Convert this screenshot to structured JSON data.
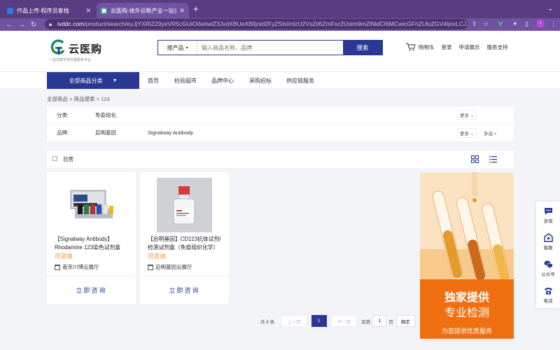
{
  "browser": {
    "tabs": [
      {
        "title": "作品上传-程序员客栈"
      },
      {
        "title": "云医购-体外诊断产业一站式服务"
      }
    ],
    "url_domain": "ivddc.com",
    "url_path": "/product/search/eyJjYXRlZ29yeVR5cGUiOiIwIiwiZ3JvdXBUeXBlIjoid2FyZSIsImlzU2VsZiI6ZmFsc2UsIm9mZlNldCI6MCwicGFnZUluZGV4IjoxLCJ...",
    "avatar_letter": "i"
  },
  "header": {
    "logo_name": "云医购",
    "logo_tagline": "一站式数字供应链服务平台",
    "search_scope": "搜产品",
    "search_placeholder": "输入商品名称、品牌",
    "search_button": "搜索",
    "links": [
      "购物车",
      "登录",
      "申请展示",
      "服务支持"
    ]
  },
  "nav": {
    "all_categories": "全部商品分类",
    "items": [
      "首页",
      "检验超市",
      "品牌中心",
      "采购招标",
      "供应链服务"
    ]
  },
  "breadcrumb": "全部商品 > 商品搜索 > 123",
  "filters": {
    "category_label": "分类:",
    "category_value": "免疫组化",
    "brand_label": "品牌:",
    "brands": [
      "启明基因",
      "Signalway Antibody"
    ],
    "more": "更多",
    "multi": "多选"
  },
  "toolbar": {
    "self_label": "自营"
  },
  "products": [
    {
      "title": "【Signalway Antibody】Rhodamine 123染色试剂盒",
      "price": "可咨询",
      "shop": "南京川博云展厅",
      "action": "立即咨询"
    },
    {
      "title": "【启明基因】CD123抗体试剂/检测试剂盒（免疫组织化学）",
      "price": "可咨询",
      "shop": "启明基因云展厅",
      "action": "立即咨询"
    }
  ],
  "banner": {
    "line1": "独家提供",
    "line2": "专业检测",
    "line3": "为您提供优质服务"
  },
  "pagination": {
    "total": "共 8 条",
    "prev": "上一页",
    "current": "1",
    "next": "下一页",
    "goto": "到第",
    "page_input": "1",
    "page_unit": "页",
    "confirm": "确定"
  },
  "float_panel": [
    "咨询",
    "客服",
    "公众号",
    "电话"
  ],
  "colors": {
    "brand": "#2a3893",
    "accent": "#f08a1f",
    "browser": "#6f52a1",
    "banner": "#f06f11"
  }
}
